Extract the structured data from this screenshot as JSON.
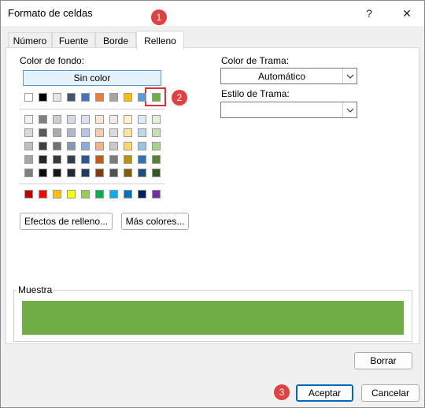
{
  "dialog": {
    "title": "Formato de celdas",
    "help_glyph": "?",
    "close_glyph": "✕"
  },
  "tabs": [
    {
      "label": "Número"
    },
    {
      "label": "Fuente"
    },
    {
      "label": "Borde"
    },
    {
      "label": "Relleno",
      "active": true
    }
  ],
  "fill": {
    "background_label": "Color de fondo:",
    "no_color_label": "Sin color",
    "selected_color": "#70ad47",
    "theme_row": [
      "#ffffff",
      "#000000",
      "#e7e6e6",
      "#44546a",
      "#4472c4",
      "#ed7d31",
      "#a5a5a5",
      "#ffc000",
      "#5b9bd5",
      "#70ad47"
    ],
    "theme_tints": [
      [
        "#f2f2f2",
        "#7f7f7f",
        "#d0cece",
        "#d6dce4",
        "#d9e2f3",
        "#fbe5d5",
        "#ededed",
        "#fff2cc",
        "#deebf6",
        "#e2efd9"
      ],
      [
        "#d8d8d8",
        "#595959",
        "#aeabab",
        "#adb9ca",
        "#b4c6e7",
        "#f7cbac",
        "#dbdbdb",
        "#fee599",
        "#bdd7ee",
        "#c5e0b3"
      ],
      [
        "#bfbfbf",
        "#3f3f3f",
        "#757171",
        "#8496b0",
        "#8eaadb",
        "#f4b183",
        "#c9c9c9",
        "#ffd965",
        "#9cc3e5",
        "#a8d08d"
      ],
      [
        "#a5a5a5",
        "#262626",
        "#3a3838",
        "#323f4f",
        "#2f5496",
        "#c55a11",
        "#7b7b7b",
        "#bf9000",
        "#2e75b5",
        "#538135"
      ],
      [
        "#7f7f7f",
        "#0c0c0c",
        "#171616",
        "#222a35",
        "#1f3864",
        "#833c0b",
        "#525252",
        "#7f6000",
        "#1e4e79",
        "#375623"
      ]
    ],
    "standard_row": [
      "#c00000",
      "#ff0000",
      "#ffc000",
      "#ffff00",
      "#92d050",
      "#00b050",
      "#00b0f0",
      "#0070c0",
      "#002060",
      "#7030a0"
    ],
    "fill_effects_label": "Efectos de relleno...",
    "more_colors_label": "Más colores..."
  },
  "pattern": {
    "color_label": "Color de Trama:",
    "color_value": "Automático",
    "style_label": "Estilo de Trama:",
    "style_value": ""
  },
  "sample": {
    "label": "Muestra",
    "color": "#70ad47"
  },
  "buttons": {
    "clear": "Borrar",
    "ok": "Aceptar",
    "cancel": "Cancelar"
  },
  "callouts": [
    "1",
    "2",
    "3"
  ]
}
